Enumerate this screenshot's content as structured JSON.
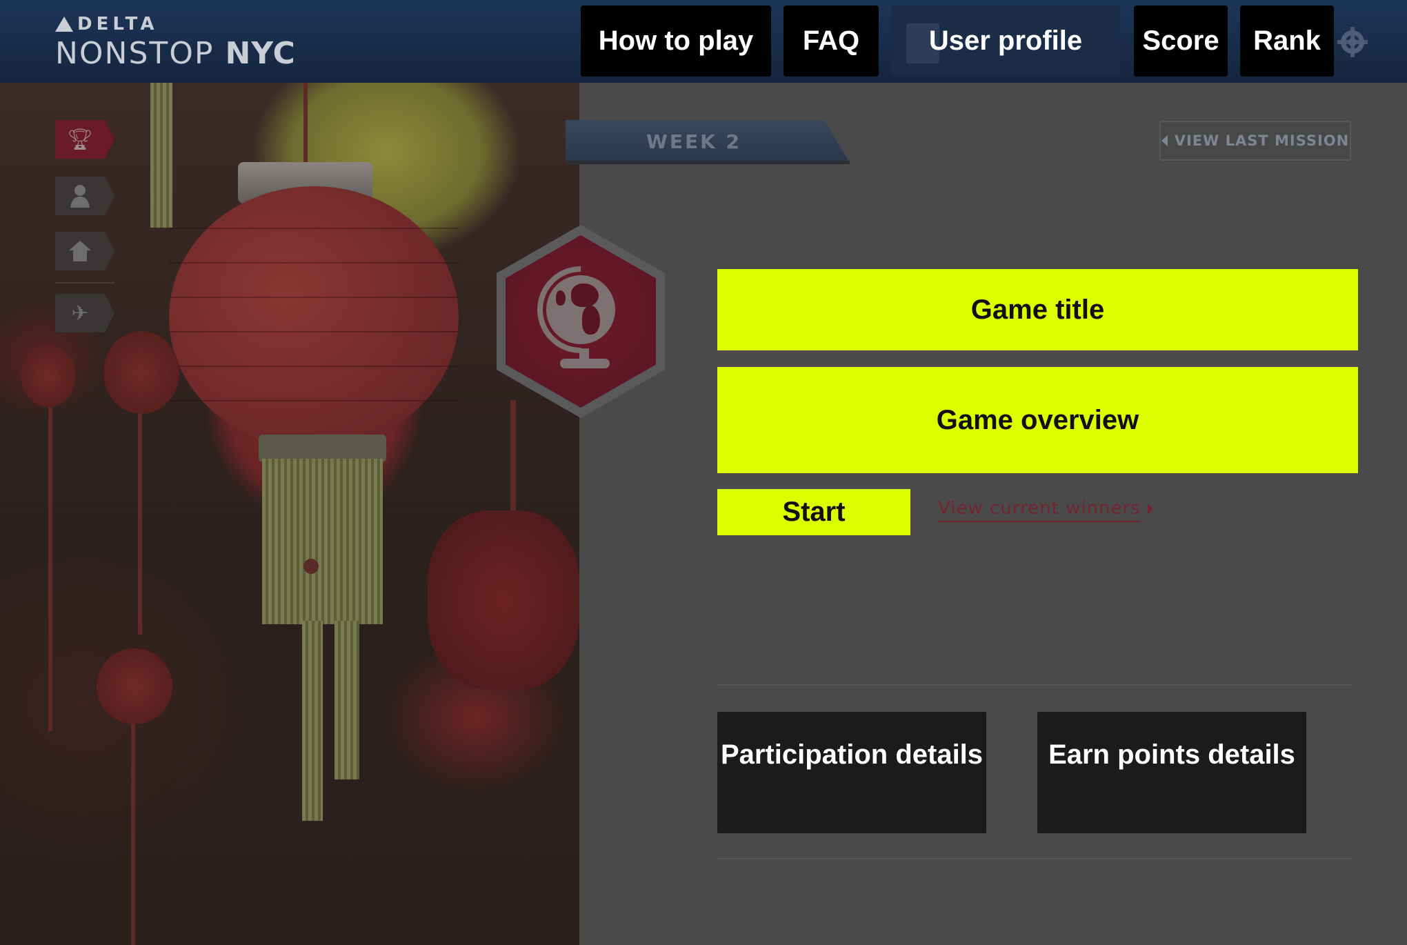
{
  "brand": {
    "top": "DELTA",
    "bottom_light": "NONSTOP",
    "bottom_bold": "NYC"
  },
  "nav": {
    "how_to_play": "How to play",
    "faq": "FAQ",
    "user_profile": "User profile",
    "score": "Score",
    "rank": "Rank",
    "settings_icon": "gear-icon"
  },
  "side_nav": [
    {
      "icon": "trophy-icon",
      "active": true
    },
    {
      "icon": "person-icon",
      "active": false
    },
    {
      "icon": "home-icon",
      "active": false
    },
    {
      "icon": "airplane-icon",
      "active": false
    }
  ],
  "week": {
    "label": "WEEK 2"
  },
  "last_mission": {
    "label": "VIEW LAST MISSION"
  },
  "badge": {
    "icon": "globe-icon"
  },
  "game": {
    "title": "Game title",
    "overview": "Game overview",
    "start": "Start"
  },
  "winners_link": {
    "label": "View current winners"
  },
  "info": {
    "participation": "Participation details",
    "earn_points": "Earn points details"
  },
  "colors": {
    "highlight": "#dcff00",
    "header": "#1d3557",
    "badge": "#6c1a2a",
    "link": "#722434",
    "panel": "#4a4a4b"
  }
}
